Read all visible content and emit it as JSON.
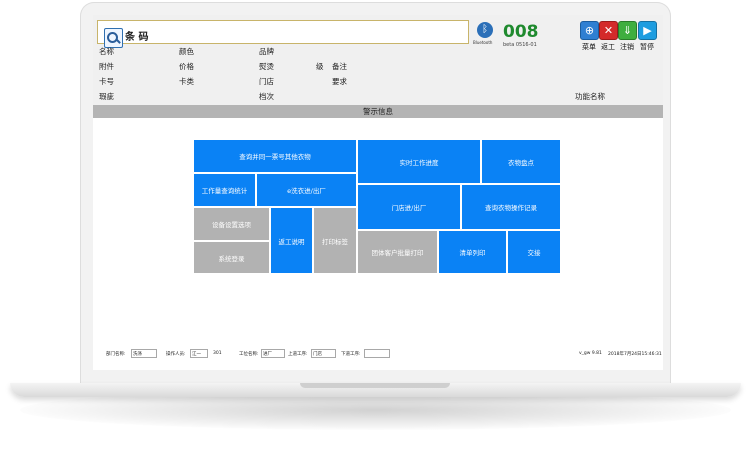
{
  "search": {
    "label": "条 码"
  },
  "status": {
    "counter": "008",
    "version": "beta 0516-01",
    "bluetooth_label": "Bluetooth"
  },
  "toolbar": {
    "menu_label": "菜单",
    "return_label": "返工",
    "logout_label": "注销",
    "pause_label": "暂停"
  },
  "fields": {
    "name": "名称",
    "color": "颜色",
    "brand": "品牌",
    "accessory": "附件",
    "price": "价格",
    "ironing": "熨烫",
    "grade": "级",
    "remark": "备注",
    "card_no": "卡号",
    "card_type": "卡类",
    "store": "门店",
    "requirement": "要求",
    "defect": "瑕疵",
    "grade_level": "档次",
    "function_name": "功能名称"
  },
  "alert": {
    "title": "警示信息"
  },
  "tiles": {
    "query_same_bag": "查询并同一票号其他衣物",
    "realtime_progress": "实时工作进度",
    "inventory": "衣物盘点",
    "workload_stats": "工作量查询统计",
    "ewash_inout": "e洗衣进/出厂",
    "store_inout": "门店进/出厂",
    "query_operation_log": "查询衣物操作记录",
    "device_settings": "设备设置选项",
    "return_instructions": "返工说明",
    "print_label": "打印标签",
    "system_login": "系统登录",
    "group_batch_print": "团体客户批量打印",
    "list_print": "清单列印",
    "handover": "交接"
  },
  "footer": {
    "dept_label": "部门名称:",
    "dept_value": "洗涤",
    "operator_label": "操作人员:",
    "operator_value": "江一",
    "operator_id": "301",
    "station_label": "工位名称:",
    "station_value": "进厂",
    "prev_step_label": "上道工序:",
    "prev_step_value": "门店",
    "next_step_label": "下道工序:",
    "next_step_value": "",
    "app_version": "v_gw 9.81",
    "datetime": "2018年7月24日15:46:31"
  }
}
